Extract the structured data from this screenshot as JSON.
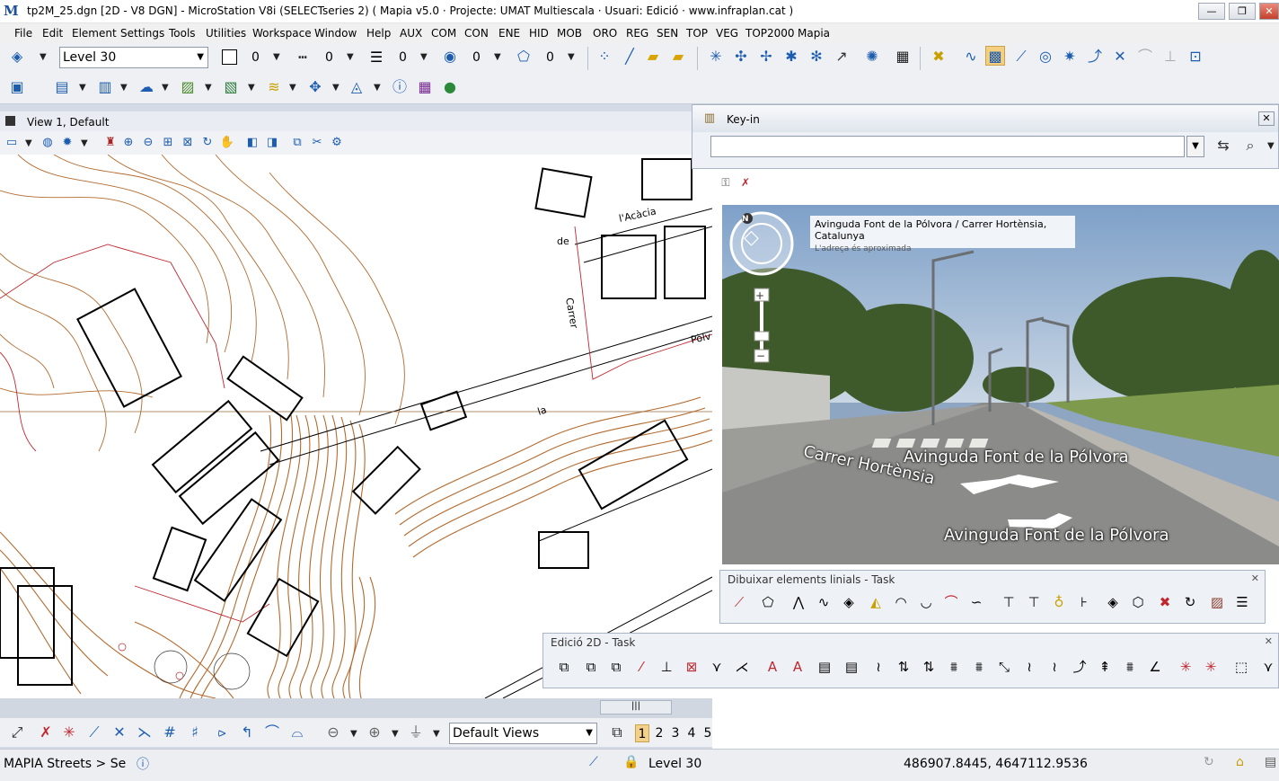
{
  "window": {
    "title": "tp2M_25.dgn [2D - V8 DGN] - MicroStation V8i (SELECTseries 2)        ( Mapia v5.0 · Projecte: UMAT Multiescala · Usuari: Edició · www.infraplan.cat )",
    "app_icon": "M",
    "minimize": "—",
    "maximize": "❐",
    "close": "✕"
  },
  "menu": [
    "File",
    "Edit",
    "Element",
    "Settings",
    "Tools",
    "Utilities",
    "Workspace",
    "Window",
    "Help",
    "AUX",
    "COM",
    "CON",
    "ENE",
    "HID",
    "MOB",
    "ORO",
    "REG",
    "SEN",
    "TOP",
    "VEG",
    "TOP2000",
    "Mapia"
  ],
  "attributes": {
    "level": "Level 30",
    "color": "0",
    "style": "0",
    "weight": "0",
    "transparency": "0",
    "priority": "0"
  },
  "view": {
    "title": "View 1, Default"
  },
  "keyin": {
    "title": "Key-in",
    "value": ""
  },
  "streetview": {
    "address": "Avinguda Font de la Pólvora / Carrer Hortènsia, Catalunya",
    "note": "L'adreça és aproximada",
    "label_carrer": "Carrer Hortènsia",
    "label_avinguda_1": "Avinguda Font de la Pólvora",
    "label_avinguda_2": "Avinguda Font de la Pólvora"
  },
  "tasks": {
    "linial": "Dibuixar elements linials - Task",
    "edicio": "Edició 2D - Task"
  },
  "bottom": {
    "views": "Default Views",
    "pages": [
      "1",
      "2",
      "3",
      "4",
      "5"
    ]
  },
  "status": {
    "prompt": "MAPIA Streets > Se",
    "level": "Level 30",
    "coords": "486907.8445, 4647112.9536"
  },
  "colors": {
    "accent": "#1d5db0",
    "contour": "#b36a2e",
    "road": "#ffffff"
  }
}
